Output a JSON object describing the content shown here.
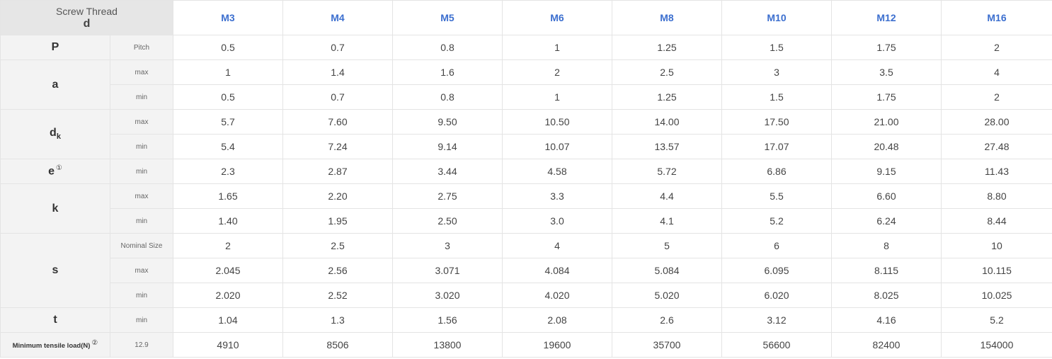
{
  "header": {
    "corner_label": "Screw Thread",
    "corner_symbol": "d",
    "sizes": [
      "M3",
      "M4",
      "M5",
      "M6",
      "M8",
      "M10",
      "M12",
      "M16"
    ]
  },
  "rows": {
    "P": {
      "label": "P",
      "sub": "Pitch",
      "values": [
        "0.5",
        "0.7",
        "0.8",
        "1",
        "1.25",
        "1.5",
        "1.75",
        "2"
      ]
    },
    "a_max": {
      "label": "a",
      "sub": "max",
      "values": [
        "1",
        "1.4",
        "1.6",
        "2",
        "2.5",
        "3",
        "3.5",
        "4"
      ]
    },
    "a_min": {
      "sub": "min",
      "values": [
        "0.5",
        "0.7",
        "0.8",
        "1",
        "1.25",
        "1.5",
        "1.75",
        "2"
      ]
    },
    "dk_max": {
      "label": "d",
      "label_sub": "k",
      "sub": "max",
      "values": [
        "5.7",
        "7.60",
        "9.50",
        "10.50",
        "14.00",
        "17.50",
        "21.00",
        "28.00"
      ]
    },
    "dk_min": {
      "sub": "min",
      "values": [
        "5.4",
        "7.24",
        "9.14",
        "10.07",
        "13.57",
        "17.07",
        "20.48",
        "27.48"
      ]
    },
    "e_min": {
      "label": "e",
      "note": "①",
      "sub": "min",
      "values": [
        "2.3",
        "2.87",
        "3.44",
        "4.58",
        "5.72",
        "6.86",
        "9.15",
        "11.43"
      ]
    },
    "k_max": {
      "label": "k",
      "sub": "max",
      "values": [
        "1.65",
        "2.20",
        "2.75",
        "3.3",
        "4.4",
        "5.5",
        "6.60",
        "8.80"
      ]
    },
    "k_min": {
      "sub": "min",
      "values": [
        "1.40",
        "1.95",
        "2.50",
        "3.0",
        "4.1",
        "5.2",
        "6.24",
        "8.44"
      ]
    },
    "s_nom": {
      "label": "s",
      "sub": "Nominal Size",
      "values": [
        "2",
        "2.5",
        "3",
        "4",
        "5",
        "6",
        "8",
        "10"
      ]
    },
    "s_max": {
      "sub": "max",
      "values": [
        "2.045",
        "2.56",
        "3.071",
        "4.084",
        "5.084",
        "6.095",
        "8.115",
        "10.115"
      ]
    },
    "s_min": {
      "sub": "min",
      "values": [
        "2.020",
        "2.52",
        "3.020",
        "4.020",
        "5.020",
        "6.020",
        "8.025",
        "10.025"
      ]
    },
    "t_min": {
      "label": "t",
      "sub": "min",
      "values": [
        "1.04",
        "1.3",
        "1.56",
        "2.08",
        "2.6",
        "3.12",
        "4.16",
        "5.2"
      ]
    },
    "tensile": {
      "label": "Minimum tensile load(N)",
      "note": "②",
      "sub": "12.9",
      "values": [
        "4910",
        "8506",
        "13800",
        "19600",
        "35700",
        "56600",
        "82400",
        "154000"
      ]
    }
  }
}
